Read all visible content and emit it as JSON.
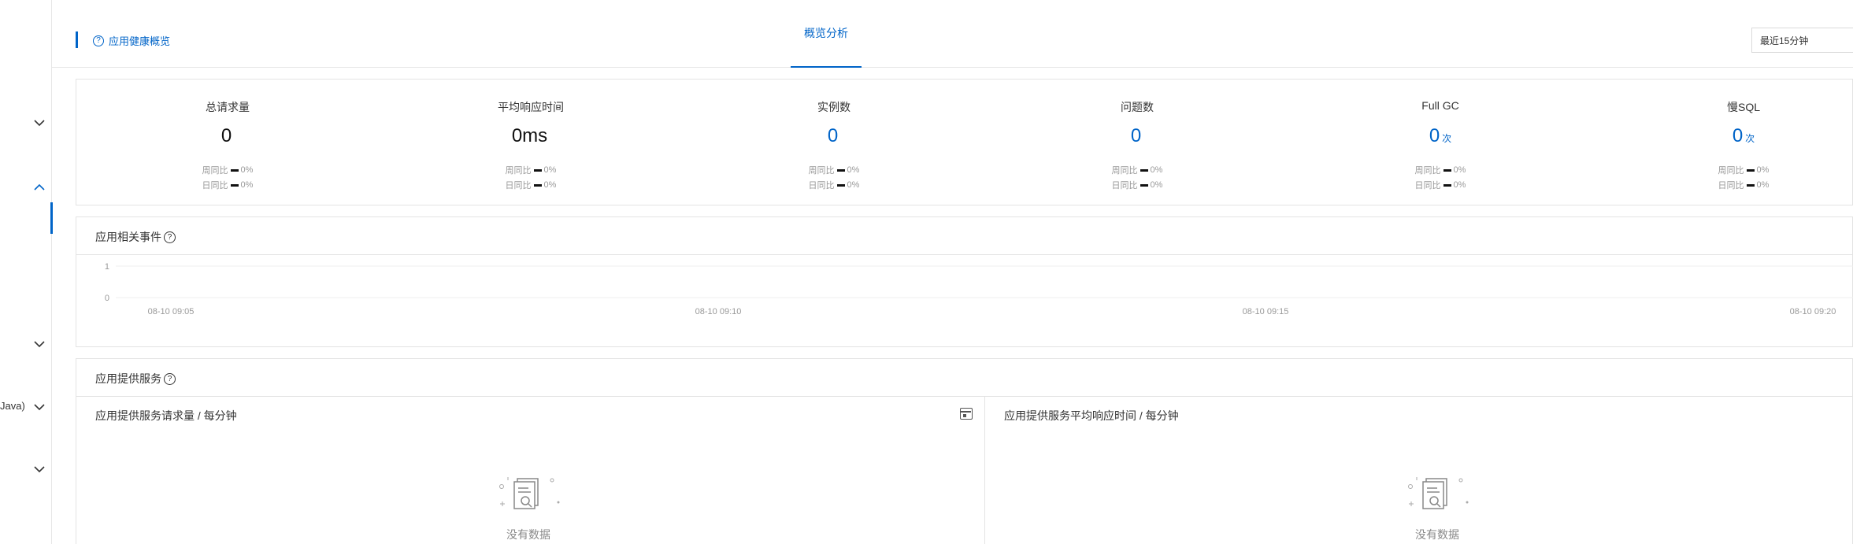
{
  "sidebar": {
    "items": [
      {
        "name": "chevron-down-1",
        "state": "collapsed"
      },
      {
        "name": "chevron-up-1",
        "state": "expanded"
      },
      {
        "name": "chevron-down-2",
        "state": "collapsed"
      },
      {
        "name": "chevron-down-3",
        "state": "collapsed"
      },
      {
        "name": "chevron-down-4",
        "state": "collapsed"
      }
    ],
    "partial_label": "Java)"
  },
  "header": {
    "health_link": "应用健康概览",
    "active_tab": "概览分析",
    "time_range": "最近15分钟"
  },
  "stats": [
    {
      "label": "总请求量",
      "value": "0",
      "unit": "",
      "week": "周同比",
      "day": "日同比",
      "week_pct": "0%",
      "day_pct": "0%",
      "blue": false
    },
    {
      "label": "平均响应时间",
      "value": "0ms",
      "unit": "",
      "week": "周同比",
      "day": "日同比",
      "week_pct": "0%",
      "day_pct": "0%",
      "blue": false
    },
    {
      "label": "实例数",
      "value": "0",
      "unit": "",
      "week": "周同比",
      "day": "日同比",
      "week_pct": "0%",
      "day_pct": "0%",
      "blue": true
    },
    {
      "label": "问题数",
      "value": "0",
      "unit": "",
      "week": "周同比",
      "day": "日同比",
      "week_pct": "0%",
      "day_pct": "0%",
      "blue": true
    },
    {
      "label": "Full GC",
      "value": "0",
      "unit": "次",
      "week": "周同比",
      "day": "日同比",
      "week_pct": "0%",
      "day_pct": "0%",
      "blue": true
    },
    {
      "label": "慢SQL",
      "value": "0",
      "unit": "次",
      "week": "周同比",
      "day": "日同比",
      "week_pct": "0%",
      "day_pct": "0%",
      "blue": true
    }
  ],
  "events": {
    "title": "应用相关事件"
  },
  "chart_data": {
    "type": "line",
    "title": "",
    "xlabel": "",
    "ylabel": "",
    "x": [
      "08-10 09:05",
      "08-10 09:10",
      "08-10 09:15",
      "08-10 09:20"
    ],
    "y_ticks": [
      "1",
      "0"
    ],
    "ylim": [
      0,
      1
    ],
    "series": [],
    "grid": true
  },
  "services": {
    "title": "应用提供服务",
    "left_title": "应用提供服务请求量 / 每分钟",
    "right_title": "应用提供服务平均响应时间 / 每分钟",
    "no_data": "没有数据"
  },
  "colors": {
    "accent": "#0064c8",
    "border": "#e3e3e3",
    "muted": "#999999"
  }
}
